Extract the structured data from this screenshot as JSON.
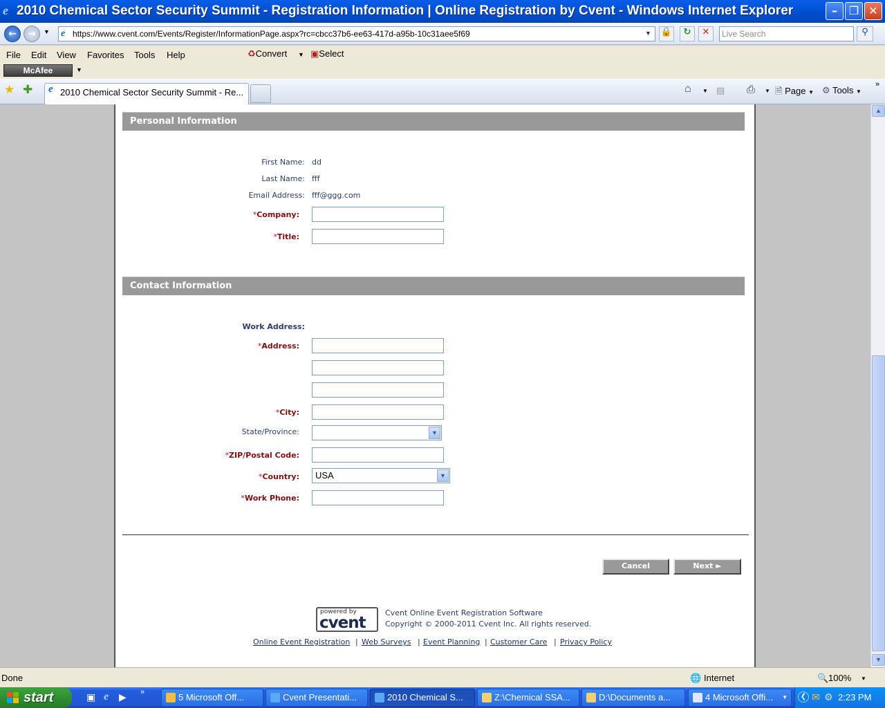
{
  "window": {
    "title": "2010 Chemical Sector Security Summit - Registration Information | Online Registration by Cvent - Windows Internet Explorer",
    "controls": [
      "minimize",
      "maximize",
      "close"
    ]
  },
  "address_bar": {
    "url": "https://www.cvent.com/Events/Register/InformationPage.aspx?rc=cbcc37b6-ee63-417d-a95b-10c31aee5f69",
    "search_placeholder": "Live Search"
  },
  "menu": {
    "items": [
      "File",
      "Edit",
      "View",
      "Favorites",
      "Tools",
      "Help"
    ],
    "convert_label": "Convert",
    "select_label": "Select"
  },
  "mcafee_label": "McAfee",
  "tabs": {
    "active_title": "2010 Chemical Sector Security Summit - Re...",
    "page_label": "Page",
    "tools_label": "Tools"
  },
  "personal": {
    "header": "Personal Information",
    "first_name_label": "First Name:",
    "first_name_value": "dd",
    "last_name_label": "Last Name:",
    "last_name_value": "fff",
    "email_label": "Email Address:",
    "email_value": "fff@ggg.com",
    "company_label": "Company:",
    "title_label": "Title:",
    "required_mark": "*"
  },
  "contact": {
    "header": "Contact Information",
    "work_address_label": "Work Address:",
    "address_label": "Address:",
    "city_label": "City:",
    "state_label": "State/Province:",
    "state_value": "",
    "zip_label": "ZIP/Postal Code:",
    "country_label": "Country:",
    "country_value": "USA",
    "phone_label": "Work Phone:"
  },
  "buttons": {
    "cancel": "Cancel",
    "next": "Next ►"
  },
  "footer": {
    "powered_by": "powered by",
    "brand": "cvent",
    "line1": "Cvent Online Event Registration Software",
    "line2": "Copyright © 2000-2011 Cvent Inc. All rights reserved.",
    "links": [
      "Online Event Registration",
      "Web Surveys",
      "Event Planning",
      "Customer Care",
      "Privacy Policy"
    ],
    "separator": "|"
  },
  "status": {
    "text": "Done",
    "zone": "Internet",
    "zoom": "100%"
  },
  "taskbar": {
    "start": "start",
    "tasks": [
      "5 Microsoft Off...",
      "Cvent Presentati...",
      "2010 Chemical S...",
      "Z:\\Chemical SSA...",
      "D:\\Documents a...",
      "4 Microsoft Offi..."
    ],
    "clock": "2:23 PM"
  },
  "colors": {
    "section_header": "#999999",
    "required_label": "#7a1010",
    "label_text": "#2c3e66",
    "titlebar": "#0052d6",
    "taskbar": "#245edb",
    "start_button": "#2f8f2f"
  }
}
